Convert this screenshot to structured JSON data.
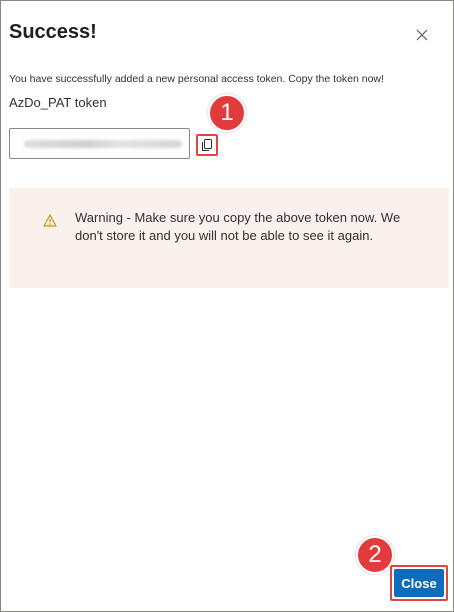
{
  "dialog": {
    "title": "Success!",
    "message": "You have successfully added a new personal access token. Copy the token now!",
    "token_label": "AzDo_PAT token",
    "close_label": "Close"
  },
  "warning": {
    "text": "Warning - Make sure you copy the above token now. We don't store it and you will not be able to see it again."
  },
  "annotations": {
    "step1": "1",
    "step2": "2"
  },
  "icons": {
    "dismiss": "close-icon",
    "copy": "copy-icon",
    "warning": "warning-icon"
  },
  "colors": {
    "primary": "#0f6cbd",
    "annotation_red": "#e23b3b",
    "warning_bg": "#fbf1ec",
    "warning_icon": "#c19c00"
  }
}
